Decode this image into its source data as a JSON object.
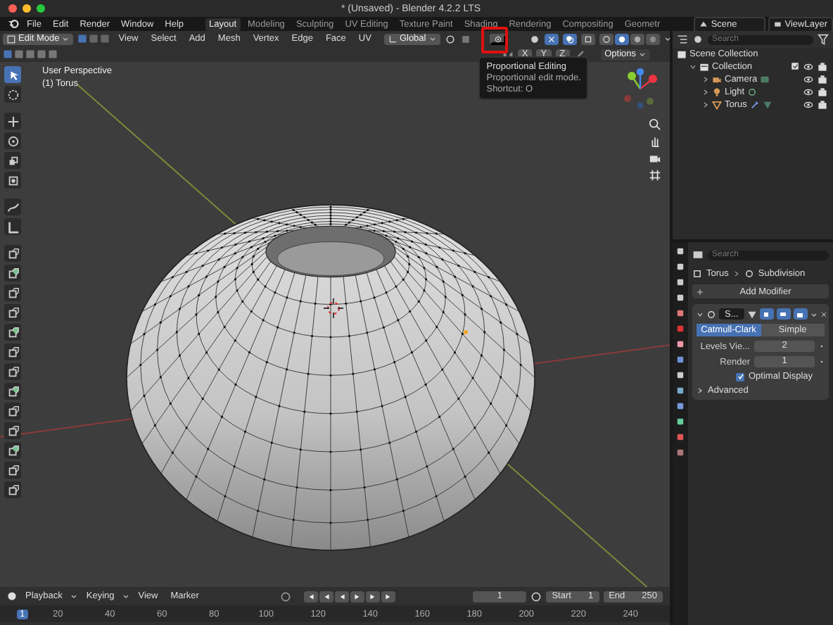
{
  "window": {
    "title": "* (Unsaved) - Blender 4.2.2 LTS"
  },
  "menu": [
    "File",
    "Edit",
    "Render",
    "Window",
    "Help"
  ],
  "workspaces": [
    {
      "label": "Layout",
      "selected": true
    },
    {
      "label": "Modeling",
      "selected": false
    },
    {
      "label": "Sculpting",
      "selected": false
    },
    {
      "label": "UV Editing",
      "selected": false
    },
    {
      "label": "Texture Paint",
      "selected": false
    },
    {
      "label": "Shading",
      "selected": false
    },
    {
      "label": "Rendering",
      "selected": false
    },
    {
      "label": "Compositing",
      "selected": false
    },
    {
      "label": "Geometr",
      "selected": false
    }
  ],
  "scene": "Scene",
  "view_layer": "ViewLayer",
  "header": {
    "mode": "Edit Mode",
    "menus": [
      "View",
      "Select",
      "Add",
      "Mesh",
      "Vertex",
      "Edge",
      "Face",
      "UV"
    ],
    "orientation": "Global",
    "proportional_editing": {
      "highlighted": true
    }
  },
  "tooltip": {
    "title": "Proportional Editing",
    "description": "Proportional edit mode.",
    "shortcut": "Shortcut: O"
  },
  "tool_settings": {
    "axes": [
      "X",
      "Y",
      "Z"
    ],
    "options": "Options"
  },
  "viewport": {
    "view_name": "User Perspective",
    "object": "(1) Torus"
  },
  "toolbar": {
    "tools": [
      {
        "selected": true
      },
      {
        "selected": false
      },
      {
        "selected": false
      },
      {
        "selected": false
      },
      {
        "selected": false
      },
      {
        "selected": false
      },
      {
        "selected": false
      },
      {
        "selected": false
      },
      {
        "selected": false
      },
      {
        "selected": false
      },
      {
        "selected": false
      },
      {
        "selected": false
      },
      {
        "selected": false
      },
      {
        "selected": false
      },
      {
        "selected": false
      },
      {
        "selected": false
      },
      {
        "selected": false
      },
      {
        "selected": false
      },
      {
        "selected": false
      },
      {
        "selected": false
      },
      {
        "selected": false
      }
    ]
  },
  "outliner": {
    "search": {
      "placeholder": "Search"
    },
    "root": "Scene Collection",
    "items": [
      {
        "label": "Collection",
        "kind": "collection",
        "expanded": true,
        "children": [
          {
            "label": "Camera",
            "kind": "camera",
            "expanded": false
          },
          {
            "label": "Light",
            "kind": "light",
            "expanded": false
          },
          {
            "label": "Torus",
            "kind": "mesh",
            "expanded": false
          }
        ]
      }
    ]
  },
  "properties": {
    "search": {
      "placeholder": "Search"
    },
    "breadcrumb": [
      "Torus",
      "Subdivision"
    ],
    "add_modifier": "Add Modifier",
    "modifier": {
      "name": "S...",
      "expanded": true
    },
    "subdivision_types": [
      {
        "label": "Catmull-Clark",
        "selected": true
      },
      {
        "label": "Simple",
        "selected": false
      }
    ],
    "fields": [
      {
        "label": "Levels Vie...",
        "value": "2"
      },
      {
        "label": "Render",
        "value": "1"
      }
    ],
    "optimal_display": {
      "label": "Optimal Display",
      "checked": true
    },
    "advanced": {
      "label": "Advanced",
      "expanded": false
    }
  },
  "timeline": {
    "menus": [
      "Playback",
      "Keying",
      "View",
      "Marker"
    ],
    "current_frame": "1",
    "start": {
      "label": "Start",
      "value": "1"
    },
    "end": {
      "label": "End",
      "value": "250"
    },
    "playhead": "1",
    "ticks": [
      "20",
      "40",
      "60",
      "80",
      "100",
      "120",
      "140",
      "160",
      "180",
      "200",
      "220",
      "240"
    ]
  }
}
